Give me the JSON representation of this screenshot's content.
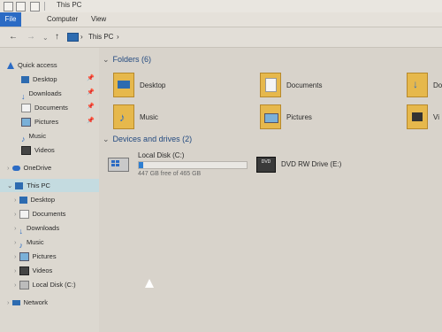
{
  "window": {
    "title": "This PC"
  },
  "ribbon": {
    "tabs": [
      "File",
      "Computer",
      "View"
    ]
  },
  "address": {
    "crumb_sep": "›",
    "location": "This PC"
  },
  "nav_buttons": {
    "back": "←",
    "forward": "→",
    "recent": "⌄",
    "up": "↑"
  },
  "sidebar": {
    "quick_access": "Quick access",
    "quick_items": [
      {
        "label": "Desktop",
        "icon": "desktop-icon"
      },
      {
        "label": "Downloads",
        "icon": "download-icon"
      },
      {
        "label": "Documents",
        "icon": "documents-icon"
      },
      {
        "label": "Pictures",
        "icon": "pictures-icon"
      },
      {
        "label": "Music",
        "icon": "music-icon"
      },
      {
        "label": "Videos",
        "icon": "videos-icon"
      }
    ],
    "onedrive": "OneDrive",
    "this_pc": "This PC",
    "pc_items": [
      {
        "label": "Desktop"
      },
      {
        "label": "Documents"
      },
      {
        "label": "Downloads"
      },
      {
        "label": "Music"
      },
      {
        "label": "Pictures"
      },
      {
        "label": "Videos"
      },
      {
        "label": "Local Disk (C:)"
      }
    ],
    "network": "Network"
  },
  "content": {
    "folders_header": "Folders (6)",
    "folders": [
      {
        "label": "Desktop"
      },
      {
        "label": "Documents"
      },
      {
        "label": "Do"
      },
      {
        "label": "Music"
      },
      {
        "label": "Pictures"
      },
      {
        "label": "Vi"
      }
    ],
    "devices_header": "Devices and drives (2)",
    "drive_c": {
      "label": "Local Disk (C:)",
      "free_text": "447 GB free of 465 GB",
      "used_fraction": 0.04
    },
    "dvd": {
      "label": "DVD RW Drive (E:)",
      "icon_text": "DVD"
    }
  },
  "colors": {
    "accent": "#2b6bc4",
    "folder": "#e6b84c",
    "header_text": "#234a80"
  }
}
